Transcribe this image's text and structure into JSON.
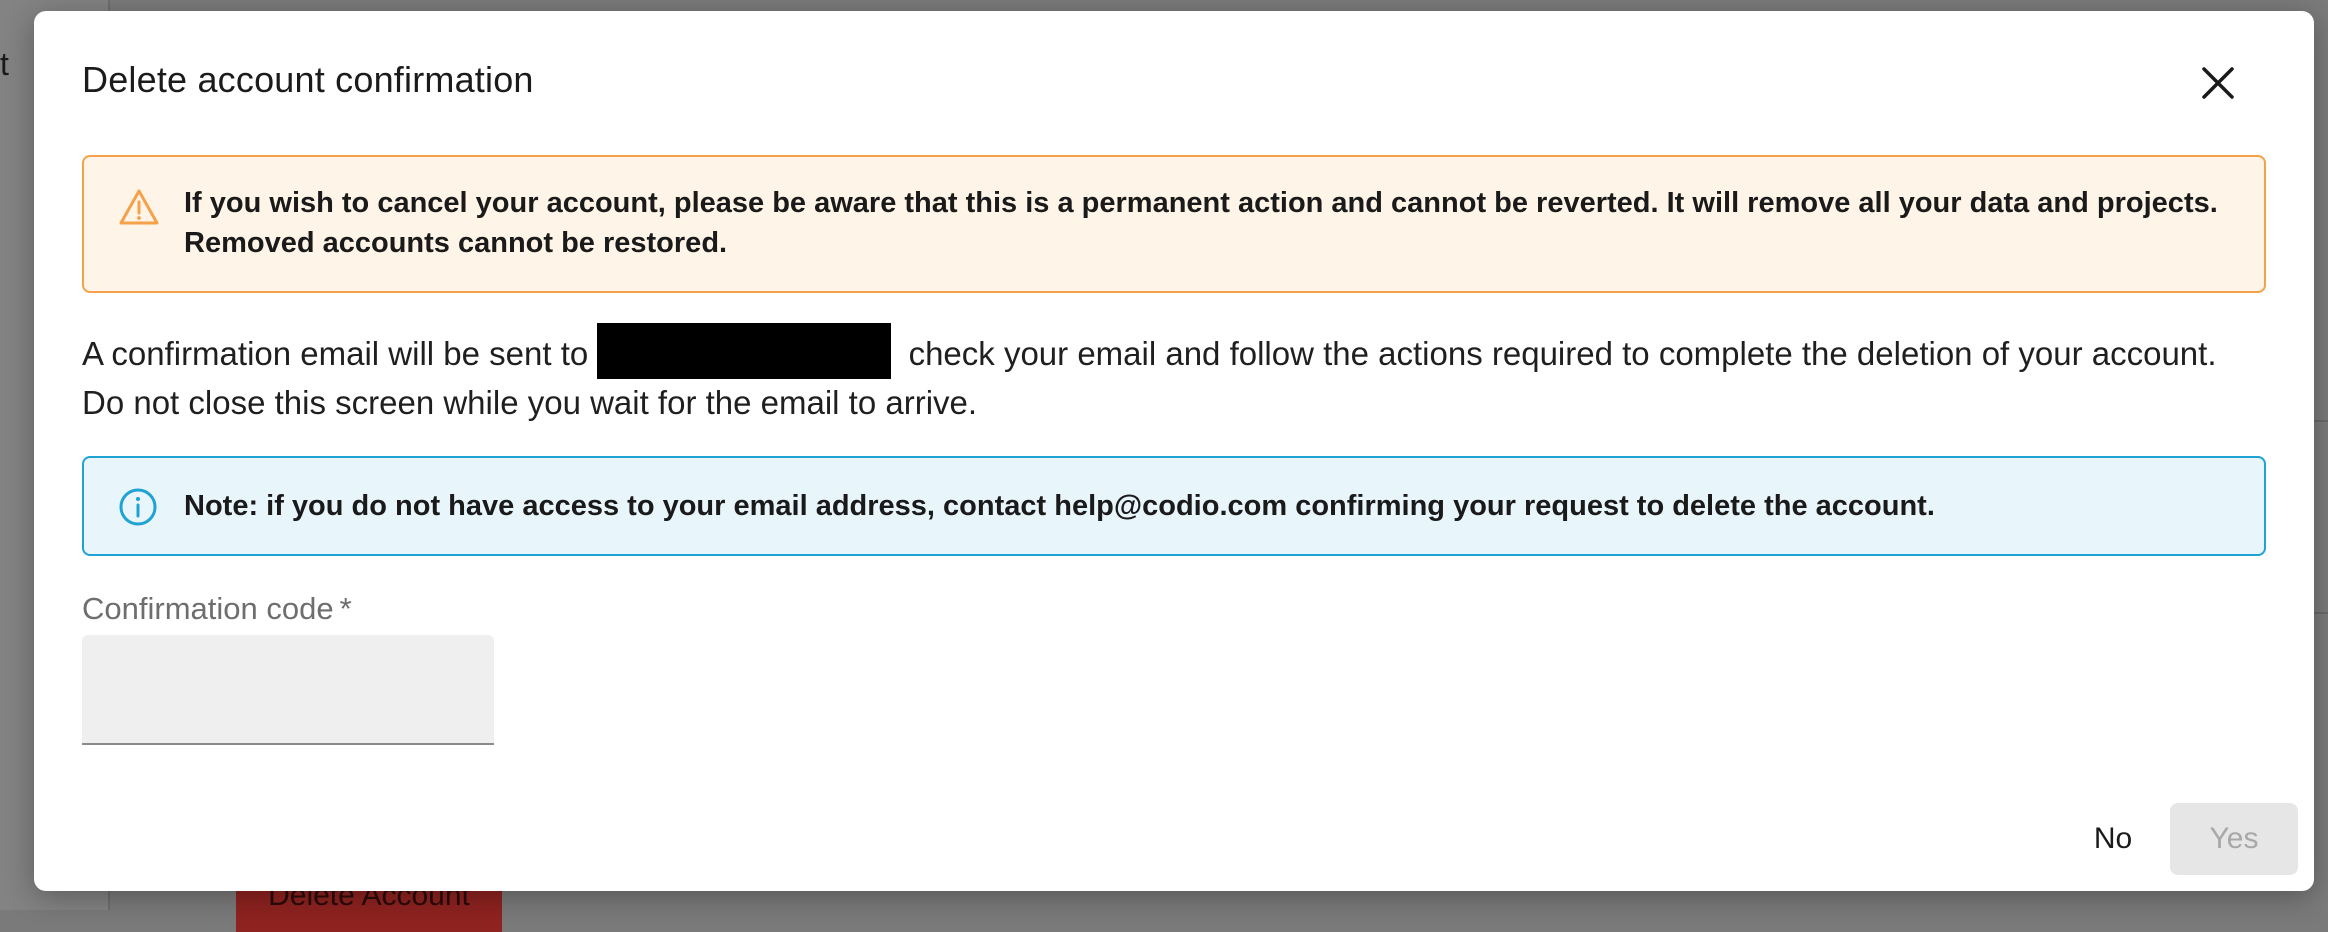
{
  "background": {
    "partial_letter": "t",
    "delete_button_label": "Delete Account"
  },
  "dialog": {
    "title": "Delete account confirmation",
    "close_icon": "close-icon",
    "warning": {
      "icon": "warning-triangle-icon",
      "color": "#f5a14a",
      "text": "If you wish to cancel your account, please be aware that this is a permanent action and cannot be reverted. It will remove all your data and projects. Removed accounts cannot be restored."
    },
    "body": {
      "text_before": "A confirmation email will be sent to",
      "text_after": "check your email and follow the actions required to complete the deletion of your account. Do not close this screen while you wait for the email to arrive."
    },
    "info": {
      "icon": "info-circle-icon",
      "color": "#1fa3d4",
      "text": "Note: if you do not have access to your email address, contact help@codio.com confirming your request to delete the account."
    },
    "field": {
      "label": "Confirmation code",
      "required_marker": "*",
      "value": ""
    },
    "actions": {
      "no_label": "No",
      "yes_label": "Yes"
    }
  }
}
